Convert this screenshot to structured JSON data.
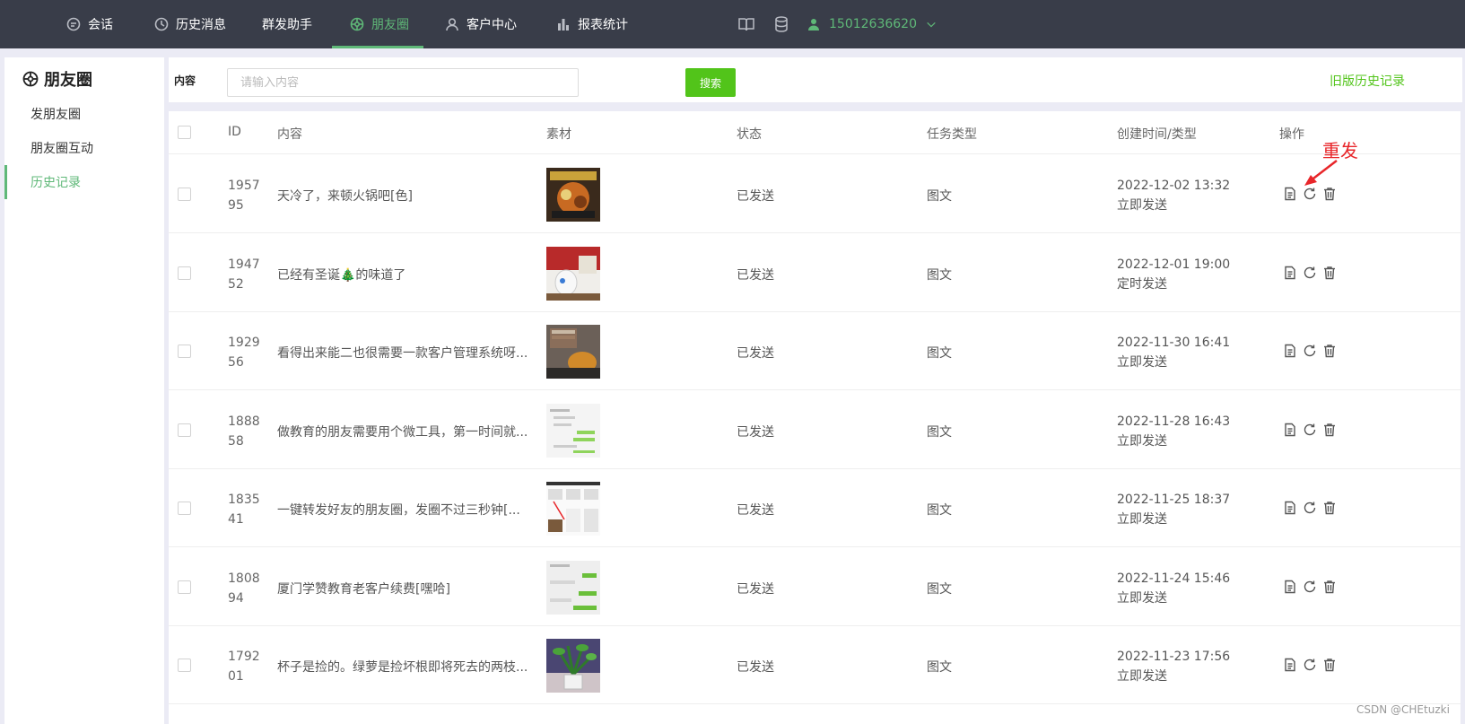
{
  "topnav": {
    "items": [
      {
        "label": "会话",
        "icon": "chat-icon"
      },
      {
        "label": "历史消息",
        "icon": "clock-icon"
      },
      {
        "label": "群发助手",
        "icon": ""
      },
      {
        "label": "朋友圈",
        "icon": "moments-icon",
        "active": true
      },
      {
        "label": "客户中心",
        "icon": "user-icon"
      },
      {
        "label": "报表统计",
        "icon": "bar-chart-icon"
      }
    ],
    "user_phone": "15012636620",
    "accent_color": "#5fb878"
  },
  "sidebar": {
    "title": "朋友圈",
    "items": [
      {
        "label": "发朋友圈"
      },
      {
        "label": "朋友圈互动"
      },
      {
        "label": "历史记录",
        "active": true
      }
    ]
  },
  "search": {
    "label": "内容",
    "placeholder": "请输入内容",
    "value": "",
    "button_label": "搜索",
    "old_history_label": "旧版历史记录"
  },
  "table": {
    "headers": {
      "id": "ID",
      "content": "内容",
      "material": "素材",
      "status": "状态",
      "task_type": "任务类型",
      "created": "创建时间/类型",
      "ops": "操作"
    },
    "rows": [
      {
        "id": "195795",
        "content": "天冷了，来顿火锅吧[色]",
        "status": "已发送",
        "type": "图文",
        "time": "2022-12-02 13:32",
        "send_type": "立即发送",
        "thumb": "hotpot"
      },
      {
        "id": "194752",
        "content": "已经有圣诞🎄的味道了",
        "status": "已发送",
        "type": "图文",
        "time": "2022-12-01 19:00",
        "send_type": "定时发送",
        "thumb": "christmas"
      },
      {
        "id": "192956",
        "content": "看得出来能二也很需要一款客户管理系统呀...",
        "status": "已发送",
        "type": "图文",
        "time": "2022-11-30 16:41",
        "send_type": "立即发送",
        "thumb": "room"
      },
      {
        "id": "188858",
        "content": "做教育的朋友需要用个微工具，第一时间就...",
        "status": "已发送",
        "type": "图文",
        "time": "2022-11-28 16:43",
        "send_type": "立即发送",
        "thumb": "chat"
      },
      {
        "id": "183541",
        "content": "一键转发好友的朋友圈，发圈不过三秒钟[...",
        "status": "已发送",
        "type": "图文",
        "time": "2022-11-25 18:37",
        "send_type": "立即发送",
        "thumb": "screen"
      },
      {
        "id": "180894",
        "content": "厦门学赞教育老客户续费[嘿哈]",
        "status": "已发送",
        "type": "图文",
        "time": "2022-11-24 15:46",
        "send_type": "立即发送",
        "thumb": "chat2"
      },
      {
        "id": "179201",
        "content": "杯子是捡的。绿萝是捡坏根即将死去的两枝...",
        "status": "已发送",
        "type": "图文",
        "time": "2022-11-23 17:56",
        "send_type": "立即发送",
        "thumb": "plant"
      }
    ]
  },
  "annotation": {
    "label": "重发",
    "color": "#e8262a"
  },
  "watermark": "CSDN @CHEtuzki"
}
